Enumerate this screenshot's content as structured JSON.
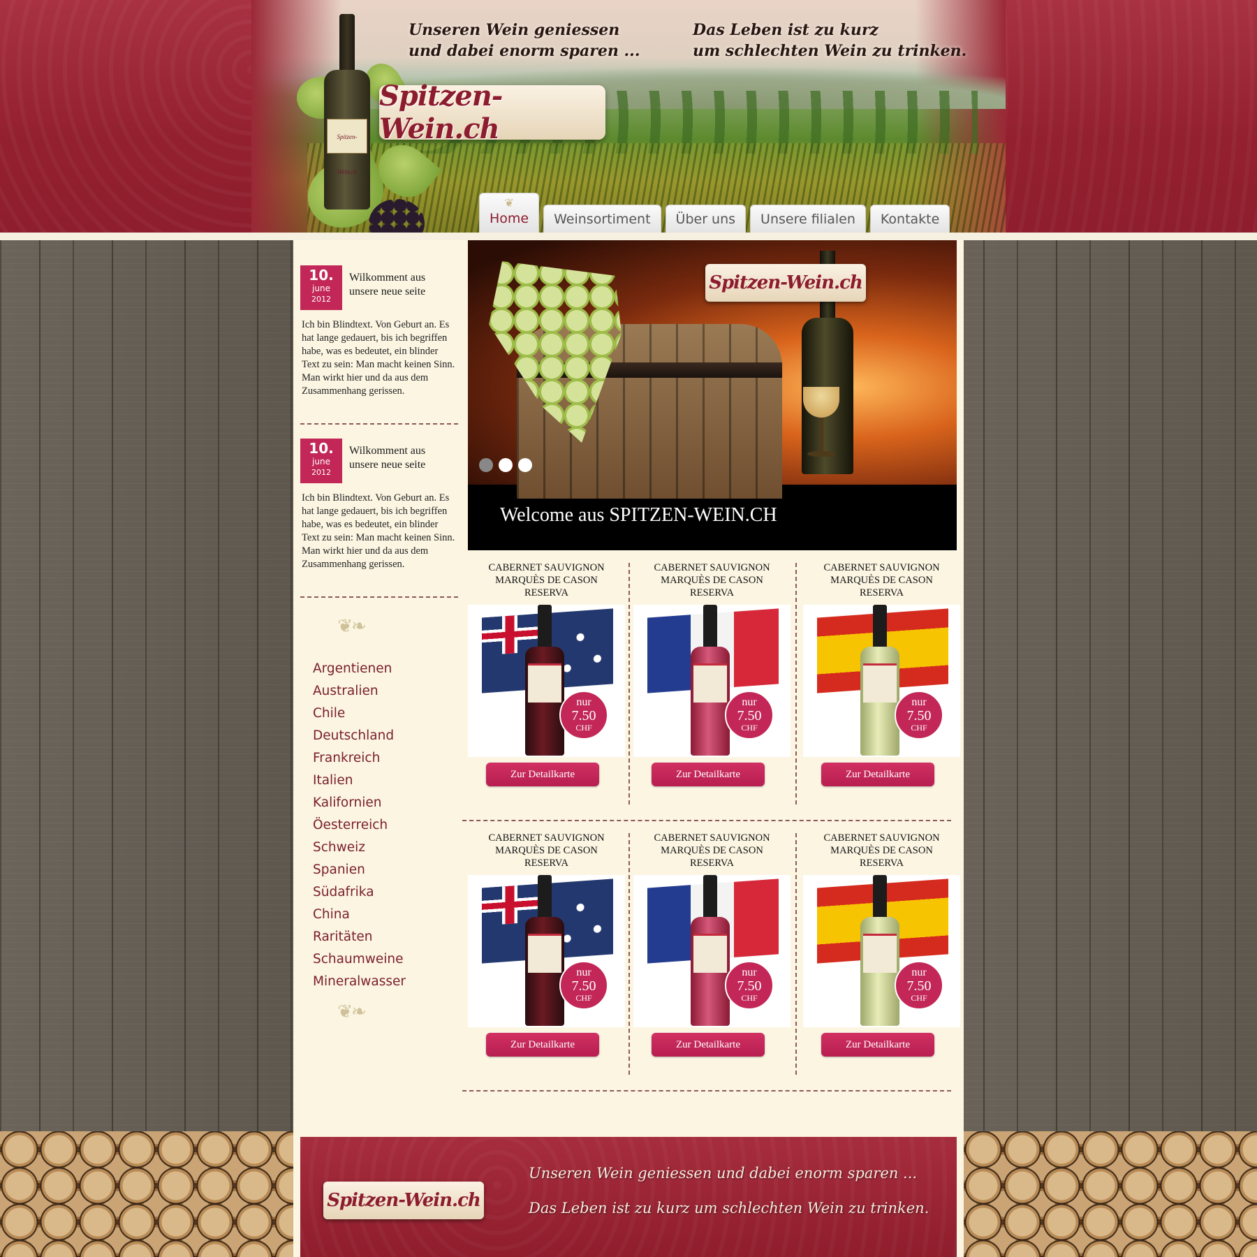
{
  "header": {
    "slogan_left_line1": "Unseren Wein geniessen",
    "slogan_left_line2": "und dabei enorm sparen ...",
    "slogan_right_line1": "Das Leben ist zu kurz",
    "slogan_right_line2": "um schlechten Wein zu trinken.",
    "logo": "Spitzen-Wein.ch",
    "bottle_label": "Spitzen-Wein.ch"
  },
  "nav": {
    "items": [
      {
        "label": "Home",
        "active": true
      },
      {
        "label": "Weinsortiment"
      },
      {
        "label": "Über uns"
      },
      {
        "label": "Unsere filialen"
      },
      {
        "label": "Kontakte"
      }
    ]
  },
  "posts": [
    {
      "day": "10.",
      "month": "june",
      "year": "2012",
      "title": "Wilkomment aus unsere neue seite",
      "text": "Ich bin Blindtext. Von Geburt an. Es hat lange gedauert, bis ich begriffen habe, was es bedeutet, ein blinder Text zu sein: Man macht keinen Sinn. Man wirkt hier und da aus dem Zusammenhang gerissen."
    },
    {
      "day": "10.",
      "month": "june",
      "year": "2012",
      "title": "Wilkomment aus unsere neue seite",
      "text": "Ich bin Blindtext. Von Geburt an. Es hat lange gedauert, bis ich begriffen habe, was es bedeutet, ein blinder Text zu sein: Man macht keinen Sinn. Man wirkt hier und da aus dem Zusammenhang gerissen."
    }
  ],
  "countries": [
    "Argentienen",
    "Australien",
    "Chile",
    "Deutschland",
    "Frankreich",
    "Italien",
    "Kalifornien",
    "Öesterreich",
    "Schweiz",
    "Spanien",
    "Südafrika",
    "China",
    "Raritäten",
    "Schaumweine",
    "Mineralwasser"
  ],
  "slider": {
    "logo": "Spitzen-Wein.ch",
    "caption": "Welcome aus SPITZEN-WEIN.CH",
    "dots": 3,
    "active_dot": 0
  },
  "products": [
    {
      "name_line1": "CABERNET SAUVIGNON",
      "name_line2": "MARQUÈS DE CASON",
      "name_line3": "RESERVA",
      "flag": "australia-flag",
      "wine": "red",
      "price_prefix": "nur",
      "price": "7.50",
      "currency": "CHF",
      "button": "Zur Detailkarte"
    },
    {
      "name_line1": "CABERNET SAUVIGNON",
      "name_line2": "MARQUÈS DE CASON",
      "name_line3": "RESERVA",
      "flag": "france-flag",
      "wine": "rose",
      "price_prefix": "nur",
      "price": "7.50",
      "currency": "CHF",
      "button": "Zur Detailkarte"
    },
    {
      "name_line1": "CABERNET SAUVIGNON",
      "name_line2": "MARQUÈS DE CASON",
      "name_line3": "RESERVA",
      "flag": "spain-flag",
      "wine": "white",
      "price_prefix": "nur",
      "price": "7.50",
      "currency": "CHF",
      "button": "Zur Detailkarte"
    },
    {
      "name_line1": "CABERNET SAUVIGNON",
      "name_line2": "MARQUÈS DE CASON",
      "name_line3": "RESERVA",
      "flag": "australia-flag",
      "wine": "red",
      "price_prefix": "nur",
      "price": "7.50",
      "currency": "CHF",
      "button": "Zur Detailkarte"
    },
    {
      "name_line1": "CABERNET SAUVIGNON",
      "name_line2": "MARQUÈS DE CASON",
      "name_line3": "RESERVA",
      "flag": "france-flag",
      "wine": "rose",
      "price_prefix": "nur",
      "price": "7.50",
      "currency": "CHF",
      "button": "Zur Detailkarte"
    },
    {
      "name_line1": "CABERNET SAUVIGNON",
      "name_line2": "MARQUÈS DE CASON",
      "name_line3": "RESERVA",
      "flag": "spain-flag",
      "wine": "white",
      "price_prefix": "nur",
      "price": "7.50",
      "currency": "CHF",
      "button": "Zur Detailkarte"
    }
  ],
  "footer": {
    "logo": "Spitzen-Wein.ch",
    "slogan_line1": "Unseren Wein geniessen und dabei enorm sparen ...",
    "slogan_line2": "Das Leben ist zu kurz um schlechten Wein zu trinken."
  },
  "colors": {
    "brand_red": "#8c1c2e",
    "accent_pink": "#c22757",
    "header_red": "#93202f",
    "panel_cream": "#fbf5e2"
  }
}
